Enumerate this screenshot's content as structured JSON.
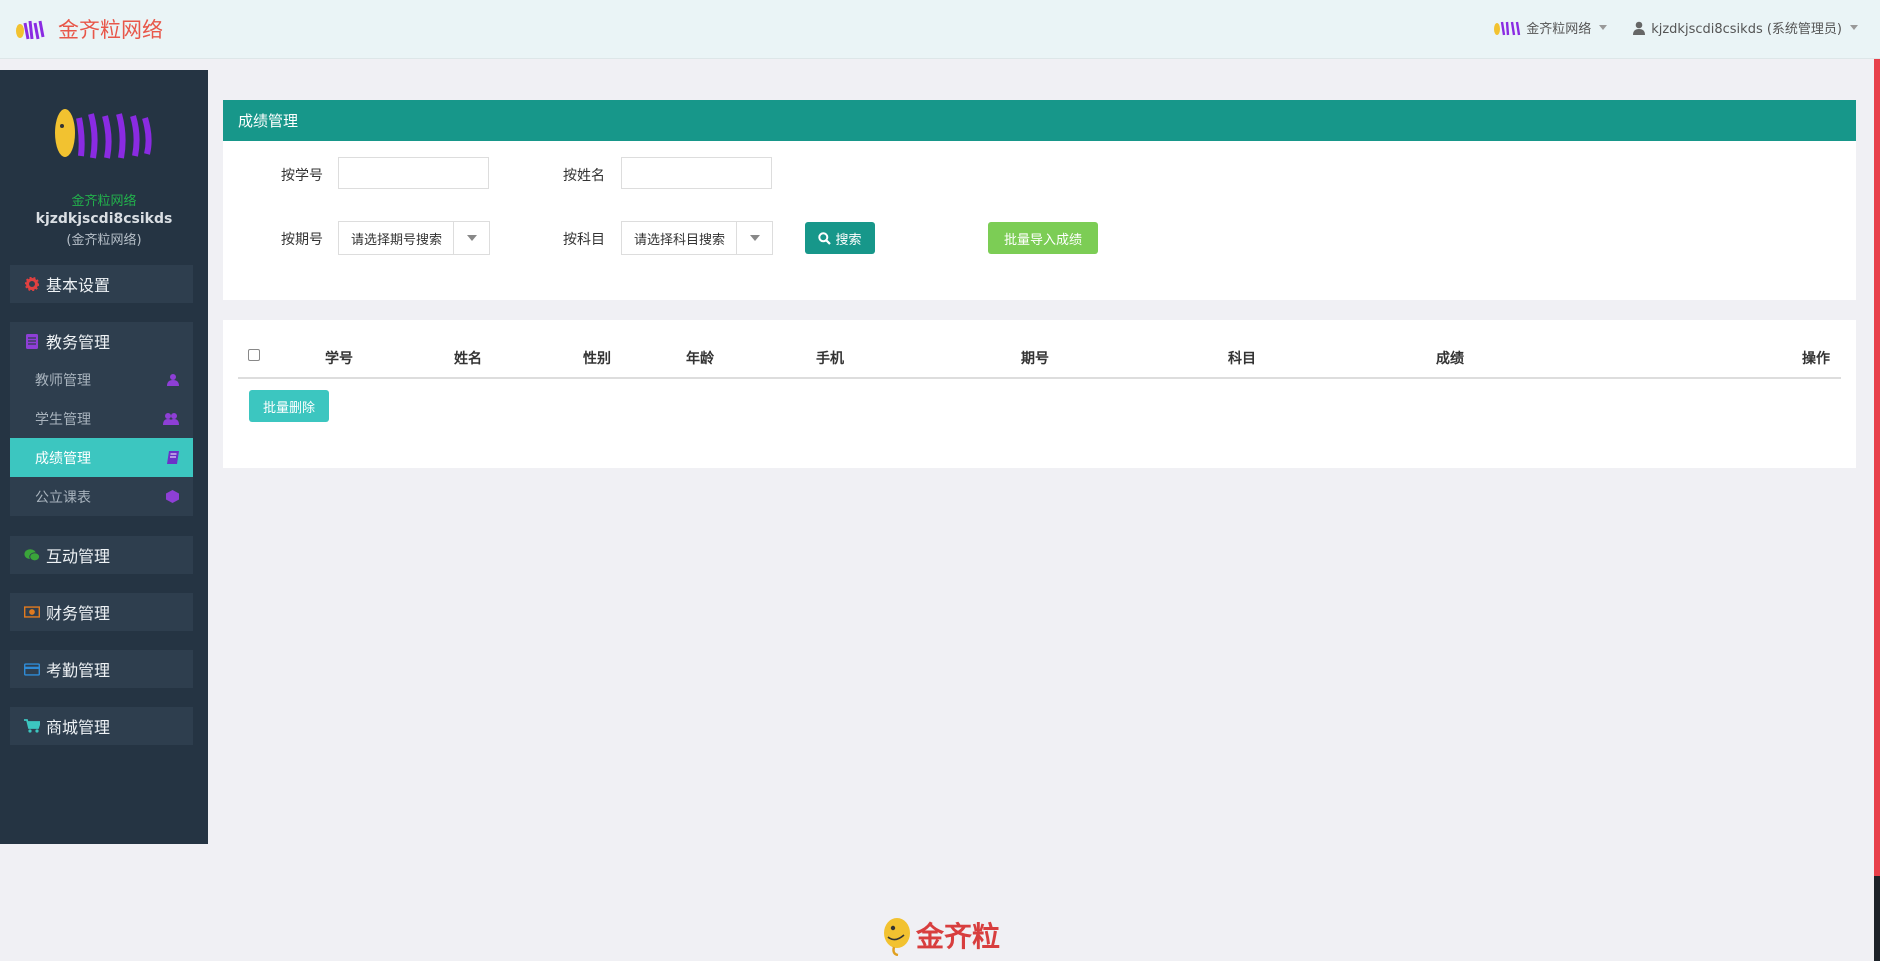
{
  "header": {
    "brand_title": "金齐粒网络",
    "org_label": "金齐粒网络",
    "user_label": "kjzdkjscdi8csikds (系统管理员)"
  },
  "sidebar": {
    "brand": "金齐粒网络",
    "username": "kjzdkjscdi8csikds",
    "org": "(金齐粒网络)",
    "groups": [
      {
        "label": "基本设置",
        "icon": "gear-icon"
      },
      {
        "label": "教务管理",
        "icon": "book-stack-icon",
        "items": [
          {
            "label": "教师管理",
            "icon": "user-icon"
          },
          {
            "label": "学生管理",
            "icon": "users-icon"
          },
          {
            "label": "成绩管理",
            "icon": "book-icon",
            "active": true
          },
          {
            "label": "公立课表",
            "icon": "cube-icon"
          }
        ]
      },
      {
        "label": "互动管理",
        "icon": "wechat-icon"
      },
      {
        "label": "财务管理",
        "icon": "money-icon"
      },
      {
        "label": "考勤管理",
        "icon": "card-icon"
      },
      {
        "label": "商城管理",
        "icon": "cart-icon"
      }
    ]
  },
  "search_panel": {
    "title": "成绩管理",
    "by_student_no": "按学号",
    "by_name": "按姓名",
    "by_term": "按期号",
    "term_select": "请选择期号搜索",
    "by_subject": "按科目",
    "subject_select": "请选择科目搜索",
    "search_button": "搜索",
    "import_button": "批量导入成绩"
  },
  "table": {
    "columns": [
      "学号",
      "姓名",
      "性别",
      "年龄",
      "手机",
      "期号",
      "科目",
      "成绩",
      "操作"
    ],
    "delete_button": "批量删除"
  },
  "footer": {
    "logo_text": "金齐粒"
  },
  "colors": {
    "primary": "#17978a",
    "accent": "#3cc6c0",
    "green": "#7ccd55",
    "sidebar": "#253443",
    "brand_red": "#e8574a"
  }
}
